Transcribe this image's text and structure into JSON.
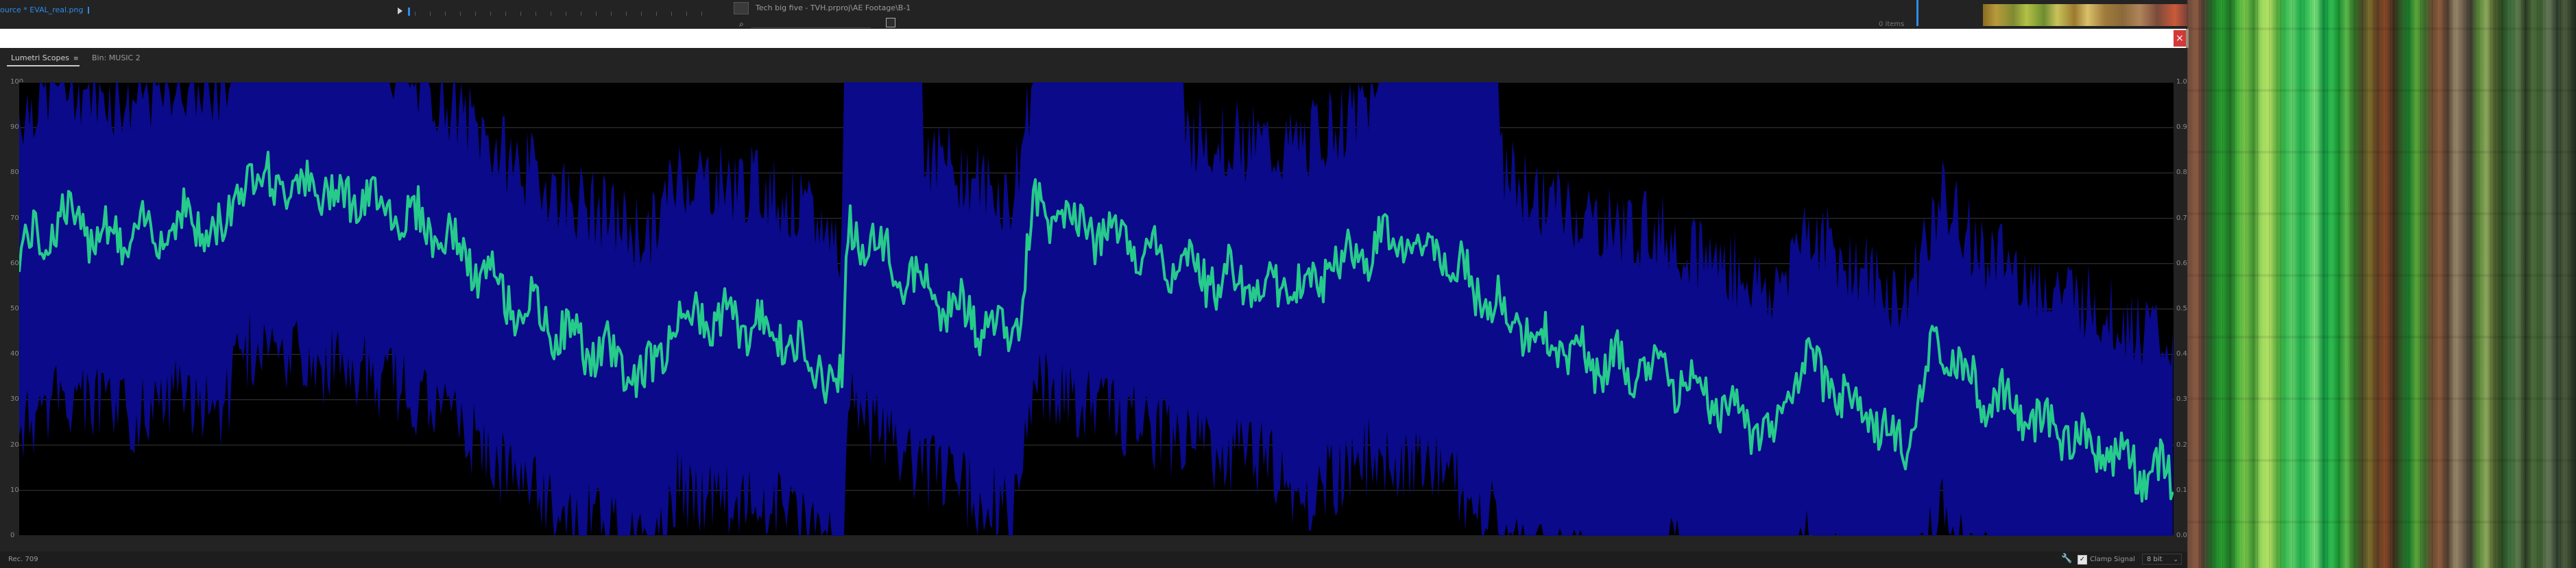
{
  "source": {
    "tab_label": "ource * EVAL_real.png"
  },
  "project": {
    "title": "Tech big five - TVH.prproj\\AE Footage\\B-1",
    "items_count": "0 items"
  },
  "window": {
    "close_label": "×"
  },
  "panel": {
    "tabs": [
      {
        "label": "Lumetri Scopes",
        "active": true,
        "menu_glyph": "≡"
      },
      {
        "label": "Bin: MUSIC 2",
        "active": false
      }
    ]
  },
  "scope": {
    "type": "waveform",
    "left_scale": [
      "100",
      "90",
      "80",
      "70",
      "60",
      "50",
      "40",
      "30",
      "20",
      "10",
      "0"
    ],
    "right_scale": [
      "1.0",
      "0.9",
      "0.8",
      "0.7",
      "0.6",
      "0.5",
      "0.4",
      "0.3",
      "0.2",
      "0.1",
      "0.0"
    ],
    "colors": {
      "background": "#000000",
      "envelope": "#0a0a8a",
      "trace": "#2ec894",
      "grid": "#3a3a3a"
    }
  },
  "footer": {
    "rec_label": "Rec. 709",
    "clamp_signal_label": "Clamp Signal",
    "clamp_signal_checked": true,
    "clamp_check_glyph": "✓",
    "bit_depth": "8 bit",
    "chevron_glyph": "⌄",
    "wrench_glyph": "🔧"
  },
  "icons": {
    "search": "⌕",
    "wrench": "wrench-icon",
    "close": "close-icon"
  }
}
